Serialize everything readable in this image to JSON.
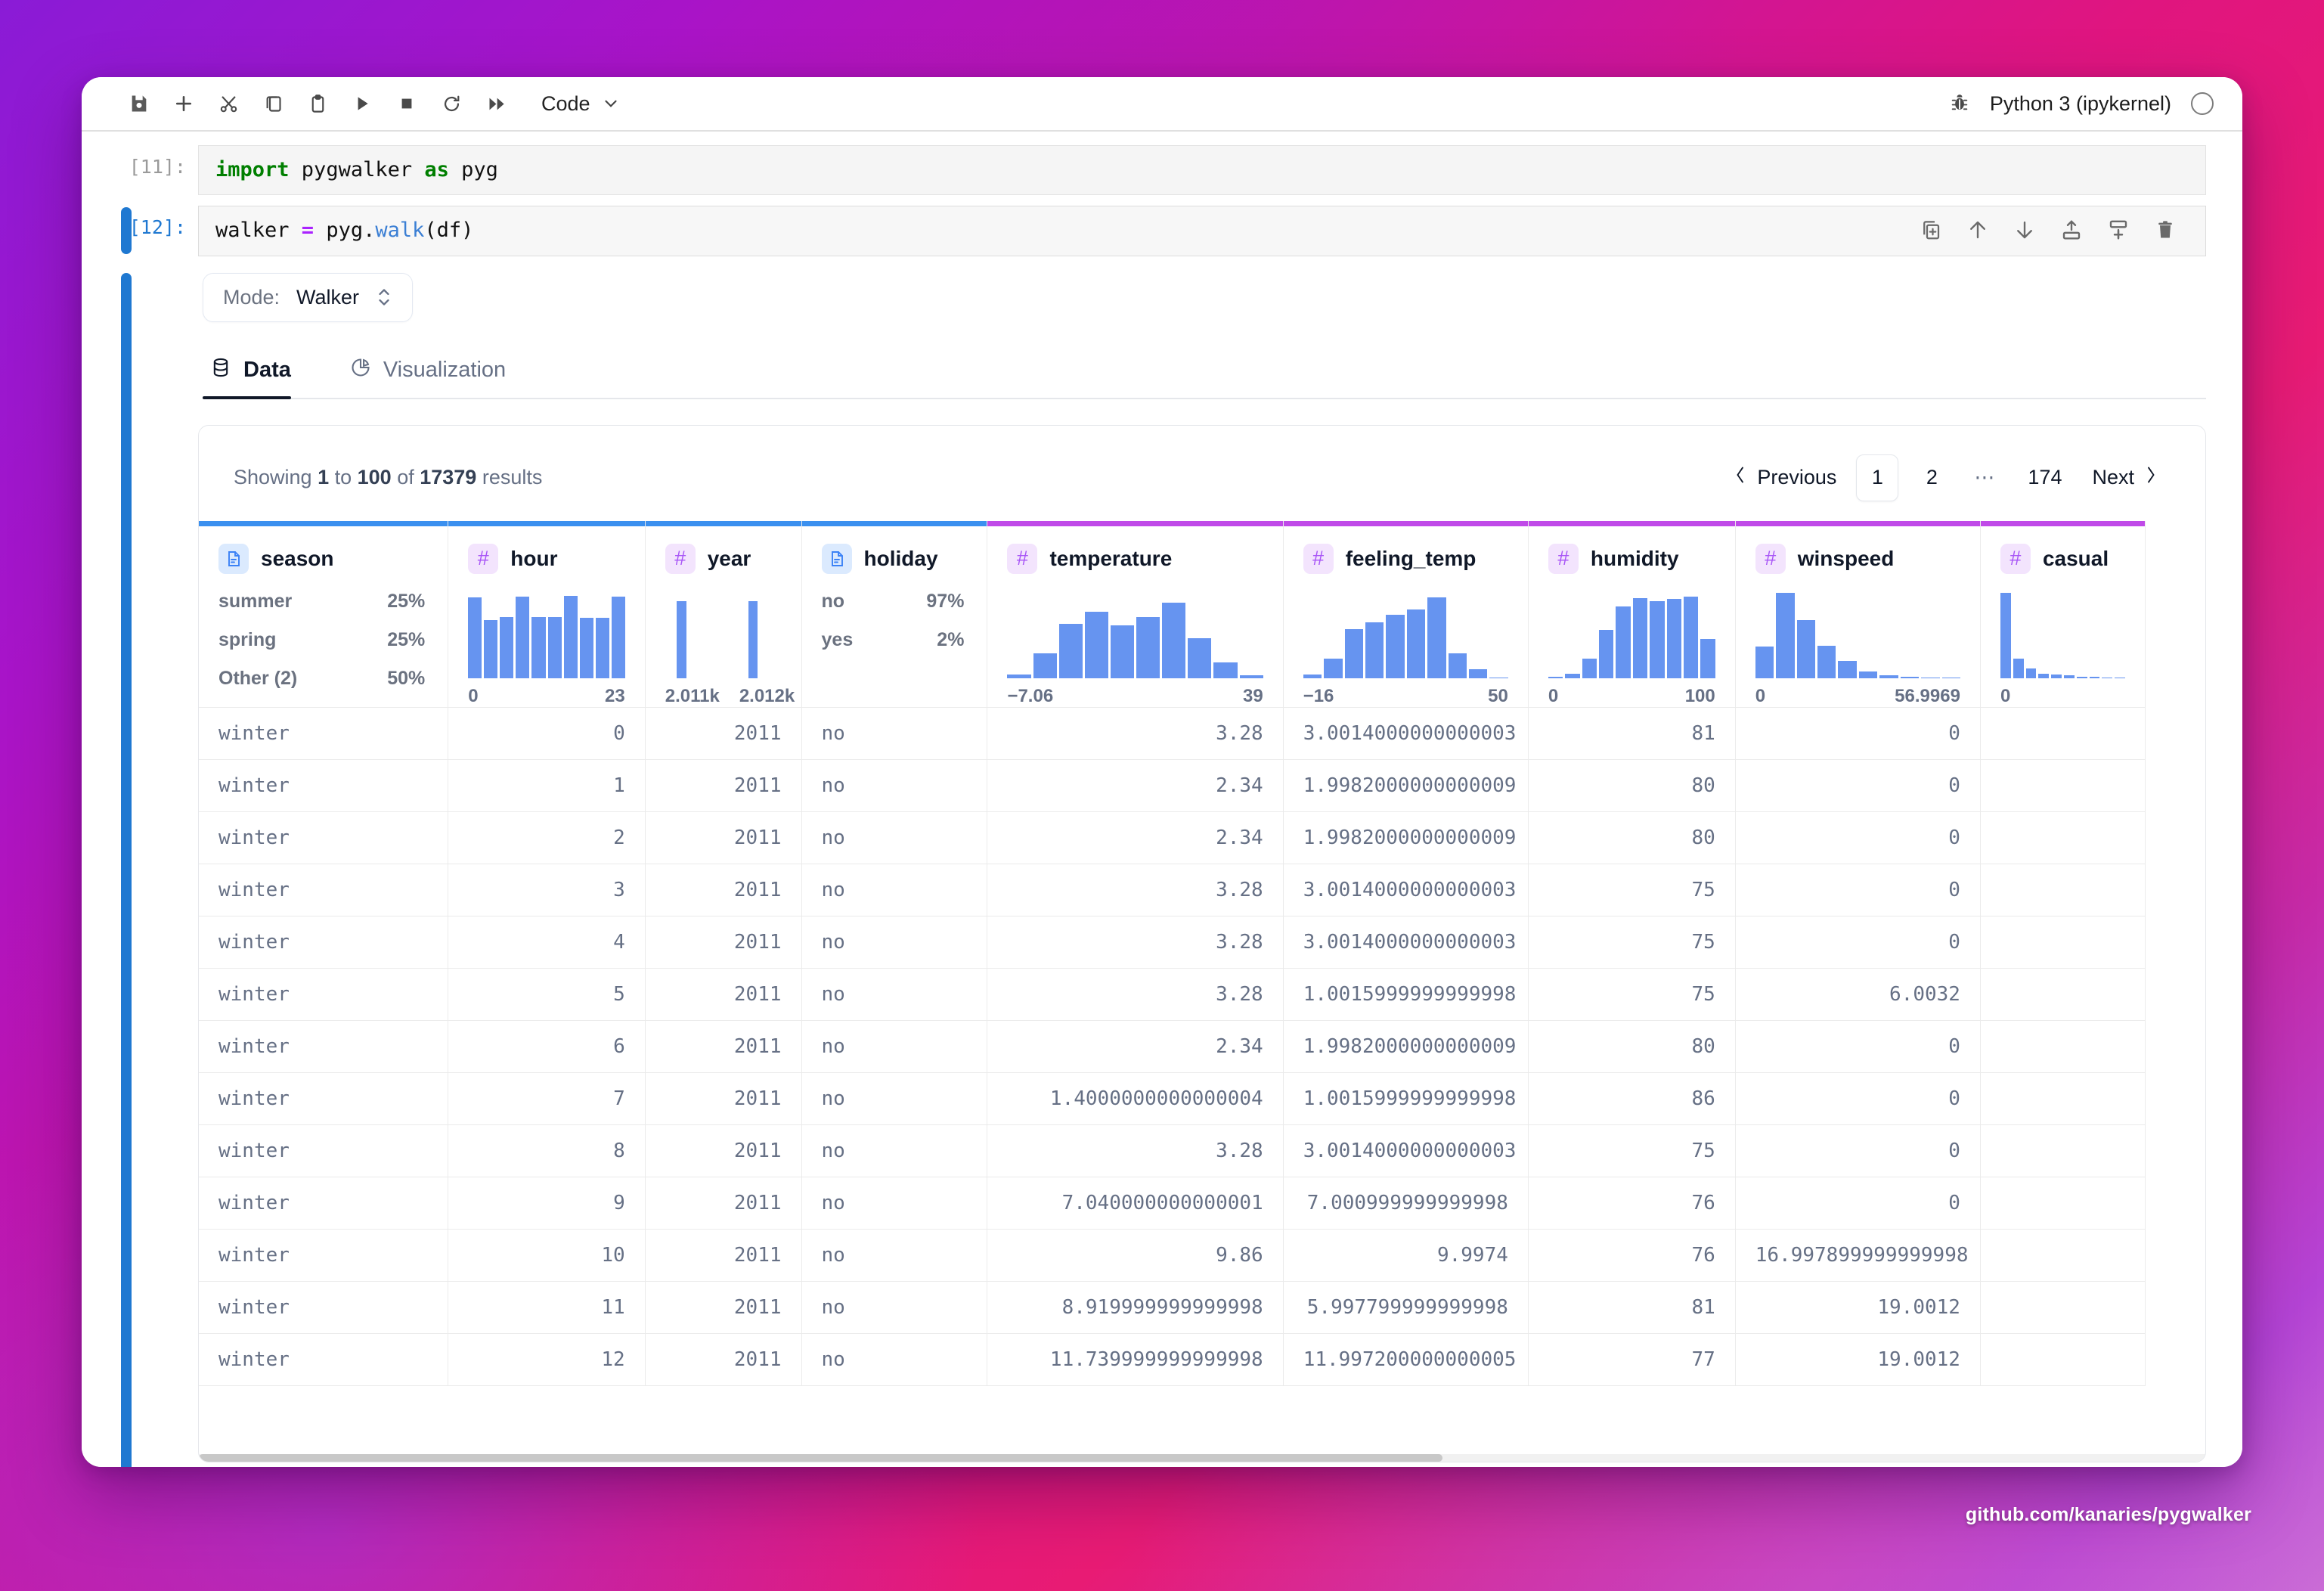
{
  "toolbar": {
    "icons": [
      {
        "name": "save-icon",
        "title": "Save"
      },
      {
        "name": "add-cell-icon",
        "title": "Insert cell"
      },
      {
        "name": "cut-icon",
        "title": "Cut"
      },
      {
        "name": "copy-icon",
        "title": "Copy"
      },
      {
        "name": "paste-icon",
        "title": "Paste"
      },
      {
        "name": "run-icon",
        "title": "Run"
      },
      {
        "name": "stop-icon",
        "title": "Interrupt"
      },
      {
        "name": "restart-icon",
        "title": "Restart"
      },
      {
        "name": "restart-run-all-icon",
        "title": "Restart and run all"
      }
    ],
    "cell_type": "Code",
    "kernel_name": "Python 3 (ipykernel)",
    "debug_icon": "bug-icon",
    "kernel_status_icon": "kernel-idle-circle"
  },
  "cells": [
    {
      "prompt": "[11]:",
      "active": false,
      "tokens": [
        {
          "t": "kw",
          "s": "import"
        },
        {
          "t": "plain",
          "s": " pygwalker "
        },
        {
          "t": "kw",
          "s": "as"
        },
        {
          "t": "plain",
          "s": " pyg"
        }
      ]
    },
    {
      "prompt": "[12]:",
      "active": true,
      "tokens": [
        {
          "t": "plain",
          "s": "walker "
        },
        {
          "t": "op",
          "s": "="
        },
        {
          "t": "plain",
          "s": " pyg."
        },
        {
          "t": "fn",
          "s": "walk"
        },
        {
          "t": "plain",
          "s": "(df)"
        }
      ]
    }
  ],
  "cell_toolbar": [
    {
      "name": "duplicate-cell-icon",
      "title": "Duplicate cell"
    },
    {
      "name": "move-cell-up-icon",
      "title": "Move cell up"
    },
    {
      "name": "move-cell-down-icon",
      "title": "Move cell down"
    },
    {
      "name": "insert-cell-above-icon",
      "title": "Insert cell above"
    },
    {
      "name": "insert-cell-below-icon",
      "title": "Insert cell below"
    },
    {
      "name": "delete-cell-icon",
      "title": "Delete cell"
    }
  ],
  "pygwalker": {
    "mode": {
      "label": "Mode:",
      "value": "Walker"
    },
    "tabs": [
      {
        "label": "Data",
        "icon": "database-icon",
        "active": true
      },
      {
        "label": "Visualization",
        "icon": "pie-chart-icon",
        "active": false
      }
    ],
    "pagination": {
      "showing_prefix": "Showing ",
      "from": "1",
      "mid1": " to ",
      "to": "100",
      "mid2": " of ",
      "total": "17379",
      "suffix": " results",
      "previous": "Previous",
      "next": "Next",
      "pages": [
        "1",
        "2"
      ],
      "ellipsis": "⋯",
      "last_page": "174",
      "current_page": "1"
    },
    "columns": [
      {
        "name": "season",
        "type": "text",
        "accent": "blue",
        "summary_type": "categorical",
        "categories": [
          {
            "key": "summer",
            "pct": "25%"
          },
          {
            "key": "spring",
            "pct": "25%"
          },
          {
            "key": "Other (2)",
            "pct": "50%"
          }
        ]
      },
      {
        "name": "hour",
        "type": "number",
        "accent": "blue",
        "summary_type": "histogram",
        "axis_min": "0",
        "axis_max": "23",
        "bins": [
          0.92,
          0.66,
          0.7,
          0.93,
          0.7,
          0.7,
          0.94,
          0.69,
          0.69,
          0.93
        ]
      },
      {
        "name": "year",
        "type": "number",
        "accent": "blue",
        "summary_type": "histogram",
        "axis_min": "2.011k",
        "axis_max": "2.012k",
        "bins": [
          0.0,
          0.88,
          0.0,
          0.0,
          0.0,
          0.0,
          0.0,
          0.88,
          0.0,
          0.0
        ]
      },
      {
        "name": "holiday",
        "type": "text",
        "accent": "blue",
        "summary_type": "categorical",
        "categories": [
          {
            "key": "no",
            "pct": "97%"
          },
          {
            "key": "yes",
            "pct": "2%"
          }
        ]
      },
      {
        "name": "temperature",
        "type": "number",
        "accent": "purple",
        "summary_type": "histogram",
        "axis_min": "−7.06",
        "axis_max": "39",
        "bins": [
          0.04,
          0.28,
          0.62,
          0.76,
          0.6,
          0.7,
          0.86,
          0.46,
          0.18,
          0.03
        ]
      },
      {
        "name": "feeling_temp",
        "type": "number",
        "accent": "purple",
        "summary_type": "histogram",
        "axis_min": "−16",
        "axis_max": "50",
        "bins": [
          0.04,
          0.22,
          0.56,
          0.64,
          0.72,
          0.78,
          0.92,
          0.28,
          0.1,
          0.01
        ]
      },
      {
        "name": "humidity",
        "type": "number",
        "accent": "purple",
        "summary_type": "histogram",
        "axis_min": "0",
        "axis_max": "100",
        "bins": [
          0.02,
          0.05,
          0.22,
          0.55,
          0.82,
          0.91,
          0.88,
          0.9,
          0.93,
          0.45
        ]
      },
      {
        "name": "winspeed",
        "type": "number",
        "accent": "purple",
        "summary_type": "histogram",
        "axis_min": "0",
        "axis_max": "56.9969",
        "bins": [
          0.36,
          0.97,
          0.66,
          0.37,
          0.2,
          0.08,
          0.03,
          0.015,
          0.008,
          0.004
        ]
      },
      {
        "name": "casual",
        "type": "number",
        "accent": "purple",
        "summary_type": "histogram",
        "axis_min": "0",
        "axis_max": "",
        "bins": [
          0.97,
          0.22,
          0.11,
          0.05,
          0.04,
          0.03,
          0.02,
          0.02,
          0.01,
          0.01
        ]
      }
    ],
    "rows": [
      [
        "winter",
        "0",
        "2011",
        "no",
        "3.28",
        "3.0014000000000003",
        "81",
        "0",
        ""
      ],
      [
        "winter",
        "1",
        "2011",
        "no",
        "2.34",
        "1.9982000000000009",
        "80",
        "0",
        ""
      ],
      [
        "winter",
        "2",
        "2011",
        "no",
        "2.34",
        "1.9982000000000009",
        "80",
        "0",
        ""
      ],
      [
        "winter",
        "3",
        "2011",
        "no",
        "3.28",
        "3.0014000000000003",
        "75",
        "0",
        ""
      ],
      [
        "winter",
        "4",
        "2011",
        "no",
        "3.28",
        "3.0014000000000003",
        "75",
        "0",
        ""
      ],
      [
        "winter",
        "5",
        "2011",
        "no",
        "3.28",
        "1.0015999999999998",
        "75",
        "6.0032",
        ""
      ],
      [
        "winter",
        "6",
        "2011",
        "no",
        "2.34",
        "1.9982000000000009",
        "80",
        "0",
        ""
      ],
      [
        "winter",
        "7",
        "2011",
        "no",
        "1.4000000000000004",
        "1.0015999999999998",
        "86",
        "0",
        ""
      ],
      [
        "winter",
        "8",
        "2011",
        "no",
        "3.28",
        "3.0014000000000003",
        "75",
        "0",
        ""
      ],
      [
        "winter",
        "9",
        "2011",
        "no",
        "7.040000000000001",
        "7.000999999999998",
        "76",
        "0",
        ""
      ],
      [
        "winter",
        "10",
        "2011",
        "no",
        "9.86",
        "9.9974",
        "76",
        "16.997899999999998",
        ""
      ],
      [
        "winter",
        "11",
        "2011",
        "no",
        "8.919999999999998",
        "5.997799999999998",
        "81",
        "19.0012",
        ""
      ],
      [
        "winter",
        "12",
        "2011",
        "no",
        "11.739999999999998",
        "11.997200000000005",
        "77",
        "19.0012",
        ""
      ]
    ]
  },
  "watermark": "github.com/kanaries/pygwalker",
  "colors": {
    "accent_blue": "#3b90ef",
    "accent_purple": "#c04ae8",
    "histogram_bar": "#6694f0",
    "cell_marker": "#1f78d1"
  }
}
